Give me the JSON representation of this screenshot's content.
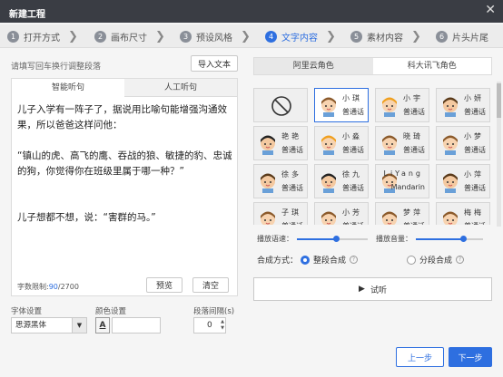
{
  "window": {
    "title": "新建工程",
    "close_glyph": "✕"
  },
  "steps": [
    {
      "num": "1",
      "label": "打开方式",
      "active": false
    },
    {
      "num": "2",
      "label": "画布尺寸",
      "active": false
    },
    {
      "num": "3",
      "label": "预设风格",
      "active": false
    },
    {
      "num": "4",
      "label": "文字内容",
      "active": true
    },
    {
      "num": "5",
      "label": "素材内容",
      "active": false
    },
    {
      "num": "6",
      "label": "片头片尾",
      "active": false
    }
  ],
  "left": {
    "hint": "请填写回车换行调整段落",
    "import_btn": "导入文本",
    "tabs": [
      "智能听句",
      "人工听句"
    ],
    "script_text": "儿子入学有一阵子了，据说用比喻句能增强沟通效果，所以爸爸这样问他：\n\n“镇山的虎、高飞的鹰、吞战的狼、敏捷的豹、忠诚的狗，你觉得你在班级里属于哪一种？”\n\n\n儿子想都不想，说：“害群的马。”",
    "count_label": "字数限制:",
    "count_current": "90",
    "count_max": "/2700",
    "preview_btn": "预览",
    "clear_btn": "清空",
    "font_label": "字体设置",
    "font_value": "思源黑体",
    "color_label": "颜色设置",
    "color_glyph": "A",
    "spacing_label": "段落间隔(s)",
    "spacing_value": "0"
  },
  "right": {
    "voice_tabs": [
      "阿里云角色",
      "科大讯飞角色"
    ],
    "voices": [
      {
        "name": "",
        "type": "",
        "kind": "none",
        "selected": false
      },
      {
        "name": "小琪",
        "type": "普通话",
        "kind": "girl",
        "selected": true
      },
      {
        "name": "小宇",
        "type": "普通话",
        "kind": "boy",
        "selected": false
      },
      {
        "name": "小妍",
        "type": "普通话",
        "kind": "man",
        "selected": false
      },
      {
        "name": "艳艳",
        "type": "普通话",
        "kind": "man2",
        "selected": false
      },
      {
        "name": "小淼",
        "type": "普通话",
        "kind": "boy",
        "selected": false
      },
      {
        "name": "晓琦",
        "type": "普通话",
        "kind": "girl",
        "selected": false
      },
      {
        "name": "小梦",
        "type": "普通话",
        "kind": "girl",
        "selected": false
      },
      {
        "name": "徐多",
        "type": "普通话",
        "kind": "man",
        "selected": false
      },
      {
        "name": "徐九",
        "type": "普通话",
        "kind": "man2",
        "selected": false
      },
      {
        "name": "LiYang",
        "type": "Mandarin",
        "kind": "girl",
        "selected": false
      },
      {
        "name": "小萍",
        "type": "普通话",
        "kind": "man",
        "selected": false
      },
      {
        "name": "子琪",
        "type": "普通话",
        "kind": "girl",
        "selected": false
      },
      {
        "name": "小芳",
        "type": "普通话",
        "kind": "girl",
        "selected": false
      },
      {
        "name": "梦萍",
        "type": "普通话",
        "kind": "girl",
        "selected": false
      },
      {
        "name": "梅梅",
        "type": "普通话",
        "kind": "girl",
        "selected": false
      }
    ],
    "speed_label": "播放语速：",
    "speed_value": 0.55,
    "volume_label": "播放音量：",
    "volume_value": 0.7,
    "mode_label": "合成方式：",
    "mode_options": [
      "整段合成",
      "分段合成"
    ],
    "mode_selected": 0,
    "help_glyph": "?",
    "try_btn": "试听",
    "play_glyph": "▶"
  },
  "footer": {
    "prev_btn": "上一步",
    "next_btn": "下一步"
  },
  "colors": {
    "accent": "#2e6fe0",
    "titlebar": "#3a3d44"
  }
}
